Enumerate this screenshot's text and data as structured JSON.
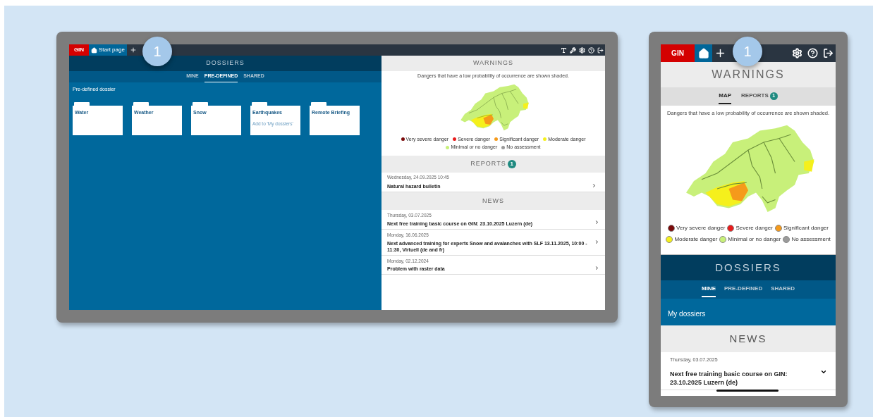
{
  "desktop": {
    "topbar": {
      "logo": "GIN",
      "tab": "Start page"
    },
    "callout": "1",
    "dossiers": {
      "title": "DOSSIERS",
      "tabs": [
        {
          "label": "MINE",
          "selected": false
        },
        {
          "label": "PRE-DEFINED",
          "selected": true
        },
        {
          "label": "SHARED",
          "selected": false
        }
      ],
      "section_title": "Pre-defined dossier",
      "folders": [
        {
          "name": "Water"
        },
        {
          "name": "Weather"
        },
        {
          "name": "Snow"
        },
        {
          "name": "Earthquakes",
          "action": "Add to 'My dossiers'"
        },
        {
          "name": "Remote Briefing"
        }
      ]
    },
    "warnings": {
      "title": "WARNINGS",
      "note": "Dangers that have a low probability of occurrence are shown shaded.",
      "legend": [
        {
          "label": "Very severe danger",
          "color": "#7a0a0a"
        },
        {
          "label": "Severe danger",
          "color": "#e81c1c"
        },
        {
          "label": "Significant danger",
          "color": "#f59a1b"
        },
        {
          "label": "Moderate danger",
          "color": "#f5f01c"
        },
        {
          "label": "Minimal or no danger",
          "color": "#c8f07a"
        },
        {
          "label": "No assessment",
          "color": "#9a9a9a"
        }
      ]
    },
    "reports": {
      "title": "REPORTS",
      "count": "1",
      "items": [
        {
          "date": "Wednesday, 24.09.2025 10:45",
          "title": "Natural hazard bulletin"
        }
      ]
    },
    "news": {
      "title": "NEWS",
      "items": [
        {
          "date": "Thursday, 03.07.2025",
          "title": "Next free training basic course on GIN: 23.10.2025 Luzern (de)"
        },
        {
          "date": "Monday, 16.06.2025",
          "title": "Next advanced training for experts Snow and avalanches with SLF 13.11.2025, 10:00 - 11:30, Virtuell (de and fr)"
        },
        {
          "date": "Monday, 02.12.2024",
          "title": "Problem with raster data"
        }
      ]
    }
  },
  "mobile": {
    "topbar": {
      "logo": "GIN"
    },
    "callout": "1",
    "warnings": {
      "title": "WARNINGS",
      "tabs": [
        {
          "label": "MAP",
          "selected": true
        },
        {
          "label": "REPORTS",
          "selected": false,
          "count": "1"
        }
      ],
      "note": "Dangers that have a low probability of occurrence are shown shaded.",
      "legend": [
        {
          "label": "Very severe danger",
          "color": "#7a0a0a"
        },
        {
          "label": "Severe danger",
          "color": "#e81c1c"
        },
        {
          "label": "Significant danger",
          "color": "#f59a1b"
        },
        {
          "label": "Moderate danger",
          "color": "#f5f01c"
        },
        {
          "label": "Minimal or no danger",
          "color": "#c8f07a"
        },
        {
          "label": "No assessment",
          "color": "#9a9a9a"
        }
      ]
    },
    "dossiers": {
      "title": "DOSSIERS",
      "tabs": [
        {
          "label": "MINE",
          "selected": true
        },
        {
          "label": "PRE-DEFINED",
          "selected": false
        },
        {
          "label": "SHARED",
          "selected": false
        }
      ],
      "section_title": "My dossiers"
    },
    "news": {
      "title": "NEWS",
      "items": [
        {
          "date": "Thursday, 03.07.2025",
          "title": "Next free training basic course on GIN: 23.10.2025 Luzern (de)"
        }
      ]
    }
  }
}
